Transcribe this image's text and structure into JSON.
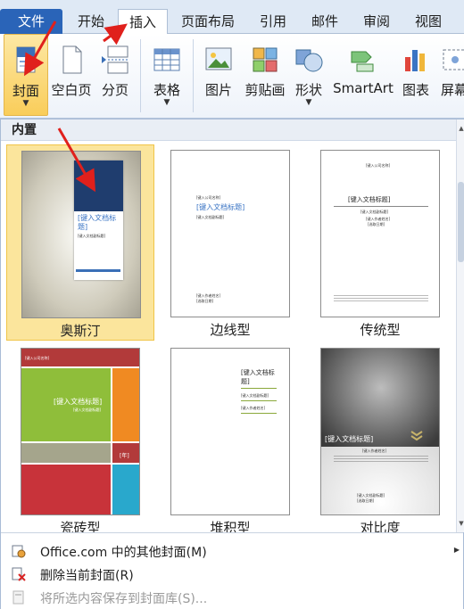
{
  "tabs": {
    "file": "文件",
    "home": "开始",
    "insert": "插入",
    "layout": "页面布局",
    "references": "引用",
    "mailings": "邮件",
    "review": "审阅",
    "view": "视图"
  },
  "ribbon": {
    "cover": "封面",
    "blank": "空白页",
    "break": "分页",
    "table": "表格",
    "picture": "图片",
    "clipart": "剪贴画",
    "shapes": "形状",
    "smartart": "SmartArt",
    "chart": "图表",
    "screenshot": "屏幕"
  },
  "gallery": {
    "section": "内置",
    "tiles": [
      {
        "label": "奥斯汀"
      },
      {
        "label": "边线型"
      },
      {
        "label": "传统型"
      },
      {
        "label": "瓷砖型"
      },
      {
        "label": "堆积型"
      },
      {
        "label": "对比度"
      }
    ],
    "placeholders": {
      "title": "[键入文档标题]",
      "title_wrap_1": "[键入文档标",
      "title_wrap_2": "题]",
      "subtitle": "[键入文档副标题]",
      "author": "[键入作者姓名]",
      "date": "[选取日期]",
      "company": "[键入公司名称]",
      "year": "[年]"
    }
  },
  "menu": {
    "more": "Office.com 中的其他封面(M)",
    "remove": "删除当前封面(R)",
    "save": "将所选内容保存到封面库(S)..."
  },
  "colors": {
    "file_tab": "#2a64b8",
    "selected_tile": "#fbe59c",
    "accent_blue": "#3a74c4",
    "arrow_red": "#e0201c"
  }
}
